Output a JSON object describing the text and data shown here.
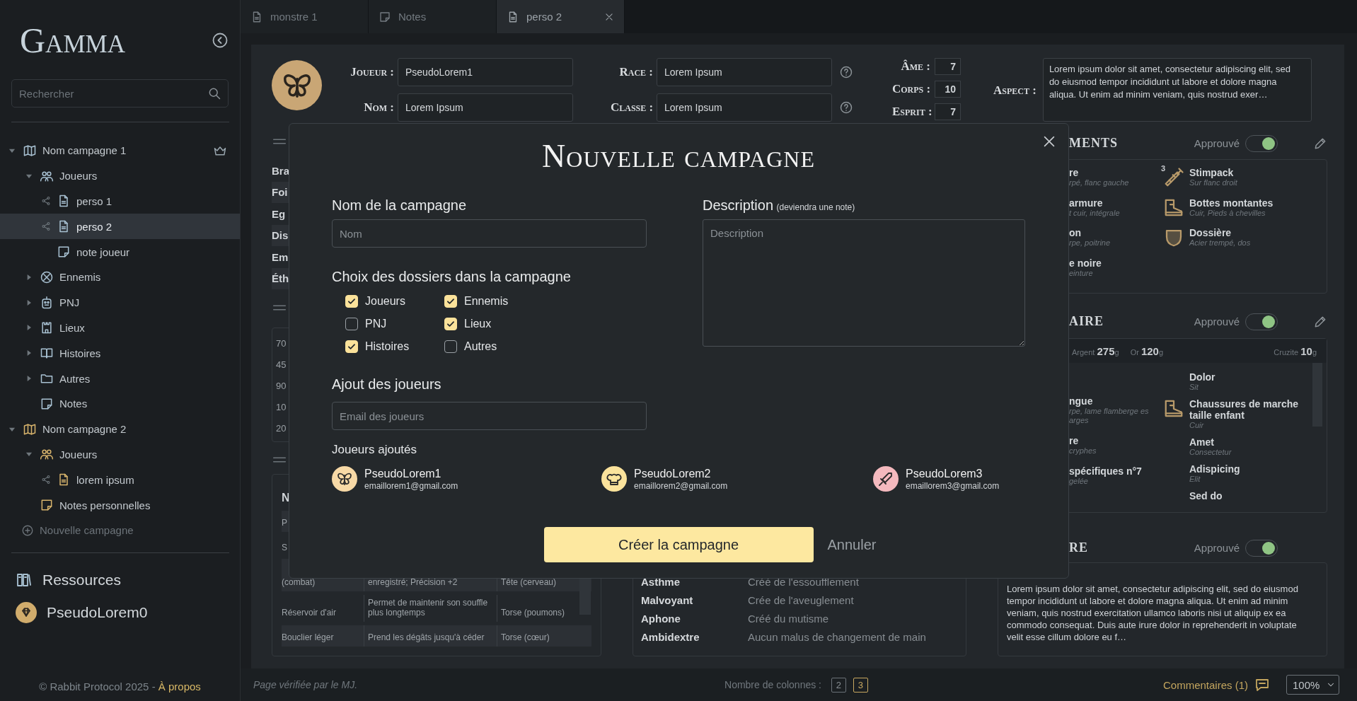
{
  "sidebar": {
    "logo": "Gamma",
    "search": {
      "placeholder": "Rechercher"
    },
    "tree": [
      {
        "label": "Nom campagne 1",
        "kind": "campaign",
        "color": "#a9c2d3",
        "owner": true,
        "expanded": true,
        "selected": false,
        "children": [
          {
            "label": "Joueurs",
            "kind": "players",
            "expanded": true,
            "selected": false,
            "children": [
              {
                "label": "perso 1",
                "kind": "sheet",
                "shared": true,
                "selected": false
              },
              {
                "label": "perso 2",
                "kind": "sheet",
                "shared": true,
                "selected": true
              },
              {
                "label": "note joueur",
                "kind": "note",
                "shared": false,
                "selected": false
              }
            ]
          },
          {
            "label": "Ennemis",
            "kind": "enemies",
            "expanded": false,
            "selected": false
          },
          {
            "label": "PNJ",
            "kind": "npc",
            "expanded": false,
            "selected": false
          },
          {
            "label": "Lieux",
            "kind": "places",
            "expanded": false,
            "selected": false
          },
          {
            "label": "Histoires",
            "kind": "stories",
            "expanded": false,
            "selected": false
          },
          {
            "label": "Autres",
            "kind": "others",
            "expanded": false,
            "selected": false
          },
          {
            "label": "Notes",
            "kind": "note",
            "shared": false,
            "selected": false
          }
        ]
      },
      {
        "label": "Nom campagne 2",
        "kind": "campaign",
        "color": "#d8b46c",
        "owner": false,
        "expanded": true,
        "selected": false,
        "children": [
          {
            "label": "Joueurs",
            "kind": "players",
            "expanded": true,
            "selected": false,
            "children": [
              {
                "label": "lorem ipsum",
                "kind": "sheet",
                "shared": true,
                "selected": false
              }
            ]
          },
          {
            "label": "Notes personnelles",
            "kind": "note",
            "shared": false,
            "selected": false
          }
        ]
      }
    ],
    "new_campaign": "Nouvelle campagne",
    "resources": "Ressources",
    "user": "PseudoLorem0",
    "footer": {
      "text": "© Rabbit Protocol 2025 - ",
      "link": "À propos"
    }
  },
  "tabs": [
    {
      "label": "monstre 1",
      "kind": "sheet",
      "selected": false
    },
    {
      "label": "Notes",
      "kind": "note",
      "selected": false
    },
    {
      "label": "perso 2",
      "kind": "sheet",
      "selected": true
    }
  ],
  "sheet": {
    "fields": [
      {
        "label": "Joueur :",
        "value": "PseudoLorem1",
        "help": false
      },
      {
        "label": "Race :",
        "value": "Lorem Ipsum",
        "help": true
      },
      {
        "label": "Nom :",
        "value": "Lorem Ipsum",
        "help": false
      },
      {
        "label": "Classe :",
        "value": "Lorem Ipsum",
        "help": true
      }
    ],
    "stats": [
      {
        "label": "Âme :",
        "value": "7"
      },
      {
        "label": "Corps :",
        "value": "10"
      },
      {
        "label": "Esprit :",
        "value": "7"
      }
    ],
    "aspect": {
      "label": "Aspect :",
      "text": "Lorem ipsum dolor sit amet, consectetur adipiscing elit, sed do eiusmod  tempor incididunt ut labore et dolore magna aliqua. Ut enim ad minim  veniam, quis nostrud exer…"
    },
    "attributes": [
      "Bra",
      "Foi",
      "Eg",
      "Dis",
      "Em",
      "Éth"
    ],
    "scores": [
      "70",
      "45",
      "90",
      "10",
      "20"
    ],
    "table": {
      "heading": "N",
      "rows": [
        {
          "cells": [
            "P"
          ]
        },
        {
          "cells": [
            "S"
          ]
        },
        {
          "cells": [
            "(combat)",
            "enregistré; Précision +2",
            "Tête (cerveau)"
          ]
        },
        {
          "cells": [
            "Réservoir d'air",
            "Permet de maintenir son souffle plus longtemps",
            "Torse (poumons)"
          ]
        },
        {
          "cells": [
            "Bouclier léger",
            "Prend les dégâts jusqu'à céder",
            "Torse (cœur)"
          ]
        }
      ]
    },
    "traits": [
      {
        "name": "Asthme",
        "effect": "Créé de l'essoufflement"
      },
      {
        "name": "Malvoyant",
        "effect": "Crée de l'aveuglement"
      },
      {
        "name": "Aphone",
        "effect": "Créé du mutisme"
      },
      {
        "name": "Ambidextre",
        "effect": "Aucun malus de changement de main"
      }
    ],
    "equipment": {
      "title": "MENTS",
      "approved_label": "Approuvé",
      "approved": true,
      "editable": true,
      "items": [
        {
          "name": "re",
          "detail": "rpé, flanc gauche"
        },
        {
          "name": "Stimpack",
          "detail": "Sur flanc droit",
          "kind": "consumable",
          "count": "3"
        },
        {
          "name": "armure",
          "detail": "t cuir, intégrale"
        },
        {
          "name": "Bottes montantes",
          "detail": "Cuir, Pieds à chevilles",
          "kind": "footwear"
        },
        {
          "name": "on",
          "detail": "rpe, poitrine"
        },
        {
          "name": "Dossière",
          "detail": "Acier trempé, dos",
          "kind": "armor"
        },
        {
          "name": "e noire",
          "detail": "einture"
        }
      ]
    },
    "inventory": {
      "title": "AIRE",
      "approved_label": "Approuvé",
      "approved": true,
      "editable": true,
      "money": [
        {
          "label": "Argent",
          "amount": "275",
          "unit": "g"
        },
        {
          "label": "Or",
          "amount": "120",
          "unit": "g"
        },
        {
          "label": "Cruzite",
          "amount": "10",
          "unit": "g"
        }
      ],
      "left_items": [
        {
          "name": "ngue",
          "detail": "rpe, lame flamberge es arges"
        },
        {
          "name": "re",
          "detail": "cryphes"
        },
        {
          "name": "spécifiques n°7",
          "detail": "gelée"
        }
      ],
      "right_items": [
        {
          "name": "Dolor",
          "detail": "Sit"
        },
        {
          "name": "Chaussures de marche taille enfant",
          "detail": "Cuir",
          "kind": "footwear"
        },
        {
          "name": "Amet",
          "detail": "Consectetur"
        },
        {
          "name": "Adispicing",
          "detail": "Elit"
        },
        {
          "name": "Sed do"
        }
      ]
    },
    "story": {
      "title": "RE",
      "approved_label": "Approuvé",
      "approved": true,
      "editable": false,
      "text": "Lorem ipsum dolor sit amet, consectetur adipiscing elit, sed do eiusmod  tempor incididunt ut labore et dolore magna aliqua. Ut enim ad minim  veniam, quis nostrud exercitation ullamco laboris nisi ut aliquip ex ea commodo consequat. Duis aute irure dolor in reprehenderit in voluptate  velit esse cillum dolore eu f…"
    }
  },
  "status_bar": {
    "note": "Page vérifiée par le MJ.",
    "columns_label": "Nombre de colonnes :",
    "columns": [
      {
        "label": "2",
        "selected": false
      },
      {
        "label": "3",
        "selected": true
      }
    ],
    "comments": "Commentaires (1)",
    "zoom": "100%"
  },
  "dialog": {
    "title": "Nouvelle campagne",
    "name_field": {
      "label": "Nom de la campagne",
      "placeholder": "Nom"
    },
    "folders": {
      "label": "Choix des dossiers dans la campagne",
      "options": [
        {
          "label": "Joueurs",
          "checked": true
        },
        {
          "label": "Ennemis",
          "checked": true
        },
        {
          "label": "PNJ",
          "checked": false
        },
        {
          "label": "Lieux",
          "checked": true
        },
        {
          "label": "Histoires",
          "checked": true
        },
        {
          "label": "Autres",
          "checked": false
        }
      ]
    },
    "players_field": {
      "label": "Ajout des joueurs",
      "placeholder": "Email des joueurs"
    },
    "added_label": "Joueurs ajoutés",
    "players": [
      {
        "name": "PseudoLorem1",
        "email": "emaillorem1@gmail.com",
        "kind": "butterfly",
        "color": "#f7d9a6"
      },
      {
        "name": "PseudoLorem2",
        "email": "emaillorem2@gmail.com",
        "kind": "chef",
        "color": "#fbe39c"
      },
      {
        "name": "PseudoLorem3",
        "email": "emaillorem3@gmail.com",
        "kind": "sword",
        "color": "#f4b9be"
      }
    ],
    "description": {
      "label": "Description",
      "hint": "(deviendra une note)",
      "placeholder": "Description"
    },
    "create_button": "Créer la campagne",
    "cancel_button": "Annuler"
  }
}
